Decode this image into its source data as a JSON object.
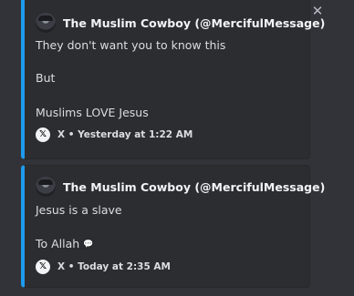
{
  "close_label": "✕",
  "embeds": [
    {
      "author": "The Muslim Cowboy (@MercifulMessage)",
      "lines": [
        "They don't want you to know this",
        "But",
        "Muslims LOVE Jesus"
      ],
      "footer": "X • Yesterday at 1:22 AM"
    },
    {
      "author": "The Muslim Cowboy (@MercifulMessage)",
      "lines": [
        "Jesus is a slave",
        "To Allah"
      ],
      "footer": "X • Today at 2:35 AM"
    }
  ],
  "icons": {
    "close": "close-icon",
    "x_logo": "x-logo-icon",
    "speech": "speech-bubble-icon"
  },
  "colors": {
    "background": "#313338",
    "embed_background": "#2b2d31",
    "accent_border": "#1d9bf0",
    "text": "#dbdee1"
  }
}
